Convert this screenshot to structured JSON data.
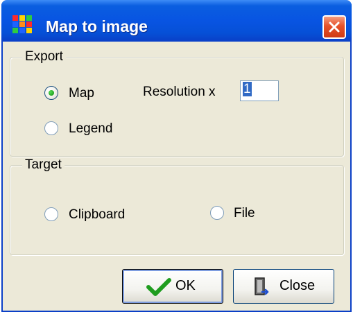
{
  "window": {
    "title": "Map to image"
  },
  "icons": {
    "app": "app-grid-icon",
    "close": "close-icon",
    "ok": "check-icon",
    "close_button": "door-exit-icon"
  },
  "colors": {
    "titlebar": "#0854e2",
    "close_button": "#e6512a",
    "dialog_bg": "#ece9d8"
  },
  "export": {
    "group_label": "Export",
    "options": [
      {
        "label": "Map",
        "checked": true
      },
      {
        "label": "Legend",
        "checked": false
      }
    ],
    "resolution_label": "Resolution x",
    "resolution_value": "1"
  },
  "target": {
    "group_label": "Target",
    "options": [
      {
        "label": "Clipboard",
        "checked": false
      },
      {
        "label": "File",
        "checked": false
      }
    ]
  },
  "buttons": {
    "ok": "OK",
    "close": "Close"
  }
}
